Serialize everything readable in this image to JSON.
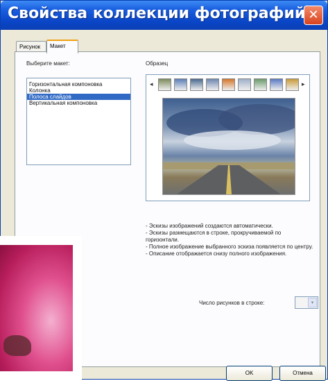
{
  "window": {
    "title": "Свойства коллекции фотографий",
    "close_glyph": "✕"
  },
  "tabs": [
    {
      "label": "Рисунок",
      "active": false
    },
    {
      "label": "Макет",
      "active": true
    }
  ],
  "layout": {
    "label": "Выберите макет:",
    "items": [
      {
        "label": "Горизонтальная компоновка",
        "selected": false
      },
      {
        "label": "Колонка",
        "selected": false
      },
      {
        "label": "Полоса слайдов",
        "selected": true
      },
      {
        "label": "Вертикальная компоновка",
        "selected": false
      }
    ]
  },
  "sample": {
    "label": "Образец",
    "prev_glyph": "◂",
    "next_glyph": "▸",
    "thumb_colors": [
      "#7d8b5c",
      "#5c7fb8",
      "#4a6a8f",
      "#6d87b0",
      "#d4762a",
      "#9fb0c9",
      "#6a9a6a",
      "#5b7ac4",
      "#c99b3a"
    ]
  },
  "description": [
    "- Эскизы изображений создаются автоматически.",
    "- Эскизы размещаются в строке, прокручиваемой по горизонтали.",
    "- Полное изображение выбранного эскиза появляется по центру.",
    "- Описание отображается снизу полного изображения."
  ],
  "images_per_row": {
    "label": "Число рисунков в строке:",
    "value": ""
  },
  "buttons": {
    "ok": "OK",
    "cancel": "Отмена"
  },
  "colors": {
    "titlebar": "#0a46c8",
    "selection": "#316ac5",
    "dialog_bg": "#ece9d8"
  }
}
